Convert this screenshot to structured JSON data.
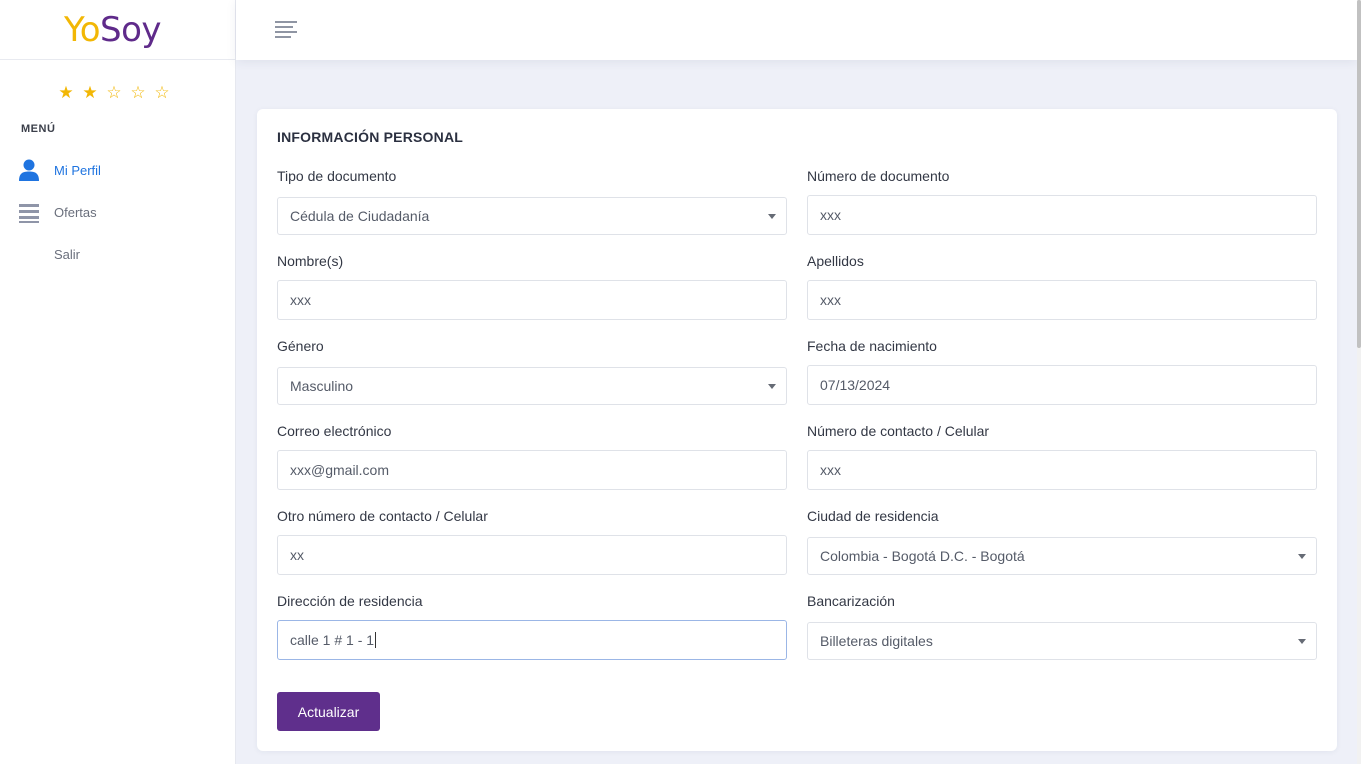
{
  "brand": {
    "part1": "Yo",
    "part2": "Soy"
  },
  "rating": {
    "value": 2,
    "max": 5,
    "filled_glyph": "★",
    "empty_glyph": "☆"
  },
  "sidebar": {
    "menu_title": "MENÚ",
    "items": [
      {
        "label": "Mi Perfil",
        "icon": "user-icon",
        "active": true
      },
      {
        "label": "Ofertas",
        "icon": "list-icon",
        "active": false
      },
      {
        "label": "Salir",
        "icon": "",
        "active": false
      }
    ]
  },
  "topbar": {
    "menu_icon": "hamburger-menu-icon"
  },
  "form": {
    "title": "INFORMACIÓN PERSONAL",
    "tipo_documento": {
      "label": "Tipo de documento",
      "value": "Cédula de Ciudadanía"
    },
    "numero_documento": {
      "label": "Número de documento",
      "value": "xxx"
    },
    "nombres": {
      "label": "Nombre(s)",
      "value": "xxx"
    },
    "apellidos": {
      "label": "Apellidos",
      "value": "xxx"
    },
    "genero": {
      "label": "Género",
      "value": "Masculino"
    },
    "fecha_nacimiento": {
      "label": "Fecha de nacimiento",
      "value": "07/13/2024"
    },
    "correo": {
      "label": "Correo electrónico",
      "value": "xxx@gmail.com"
    },
    "celular": {
      "label": "Número de contacto / Celular",
      "value": "xxx"
    },
    "otro_celular": {
      "label": "Otro número de contacto / Celular",
      "value": "xx"
    },
    "ciudad": {
      "label": "Ciudad de residencia",
      "value": "Colombia - Bogotá D.C. - Bogotá"
    },
    "direccion": {
      "label": "Dirección de residencia",
      "value": "calle 1 # 1 - 1"
    },
    "bancarizacion": {
      "label": "Bancarización",
      "value": "Billeteras digitales"
    },
    "submit_label": "Actualizar"
  },
  "colors": {
    "brand_yellow": "#f2b705",
    "brand_purple": "#5f2a8a",
    "active_blue": "#1f74e0",
    "button_purple": "#5f2f8c",
    "page_bg": "#eef0f8"
  }
}
